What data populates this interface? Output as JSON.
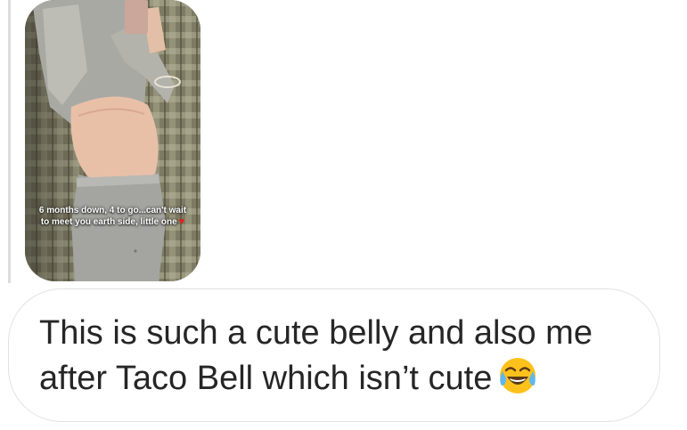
{
  "story": {
    "caption": "6 months down, 4 to go...can't wait to meet you earth side, little one",
    "caption_icon": "red-heart-icon"
  },
  "message": {
    "text": "This is such a cute belly and also me after Taco Bell which isn’t cute",
    "emoji_icon": "face-with-tears-of-joy-icon"
  },
  "colors": {
    "bubble_border": "#e2e2e2",
    "text": "#262626",
    "heart": "#e0201c"
  }
}
